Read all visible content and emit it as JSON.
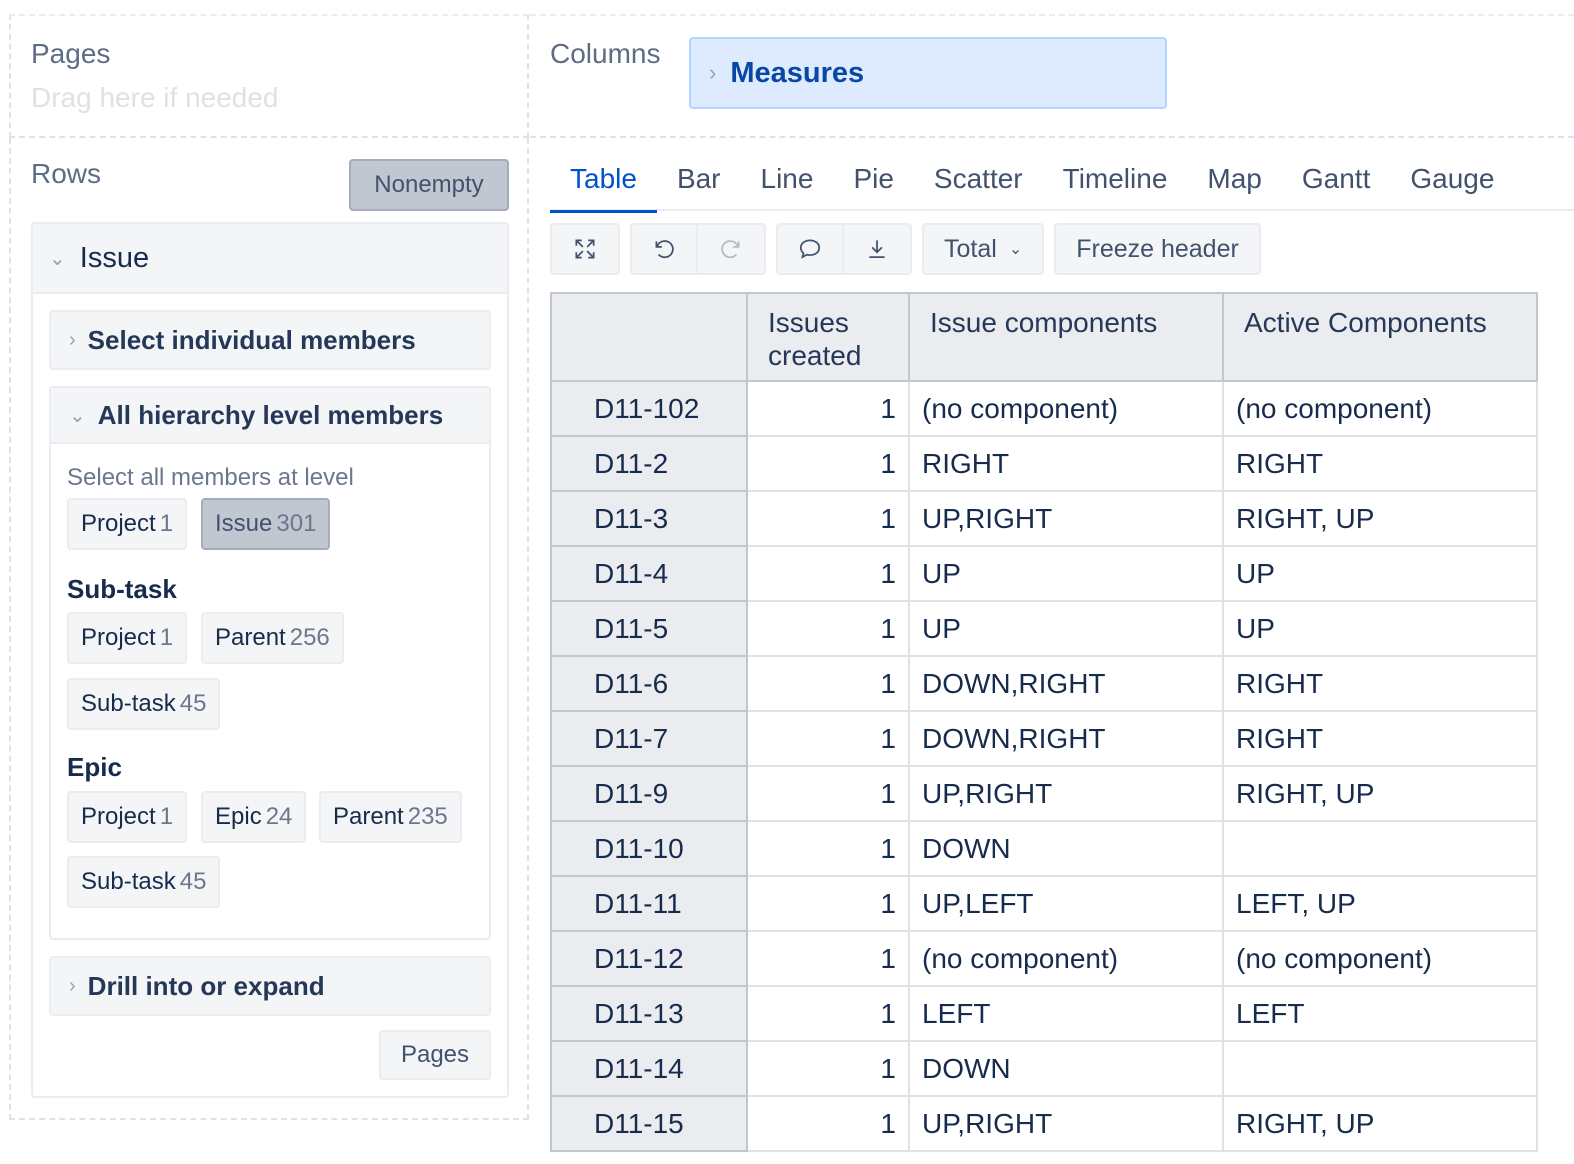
{
  "pages": {
    "title": "Pages",
    "hint": "Drag here if needed"
  },
  "columns": {
    "title": "Columns",
    "measures_label": "Measures"
  },
  "rows": {
    "title": "Rows",
    "nonempty_label": "Nonempty",
    "dimension": "Issue",
    "select_individual": "Select individual members",
    "all_hierarchy": "All hierarchy level members",
    "level_caption": "Select all members at level",
    "default_levels": [
      {
        "label": "Project",
        "count": "1"
      },
      {
        "label": "Issue",
        "count": "301"
      }
    ],
    "subtask_group": {
      "title": "Sub-task",
      "levels": [
        {
          "label": "Project",
          "count": "1"
        },
        {
          "label": "Parent",
          "count": "256"
        },
        {
          "label": "Sub-task",
          "count": "45"
        }
      ]
    },
    "epic_group": {
      "title": "Epic",
      "levels": [
        {
          "label": "Project",
          "count": "1"
        },
        {
          "label": "Epic",
          "count": "24"
        },
        {
          "label": "Parent",
          "count": "235"
        },
        {
          "label": "Sub-task",
          "count": "45"
        }
      ]
    },
    "drill": "Drill into or expand",
    "pages_button": "Pages"
  },
  "tabs": [
    "Table",
    "Bar",
    "Line",
    "Pie",
    "Scatter",
    "Timeline",
    "Map",
    "Gantt",
    "Gauge"
  ],
  "active_tab": "Table",
  "toolbar": {
    "icons": [
      "fullscreen-icon",
      "undo-icon",
      "redo-icon",
      "comment-icon",
      "download-icon"
    ],
    "total_label": "Total",
    "freeze_label": "Freeze header"
  },
  "table": {
    "headers": [
      "",
      "Issues created",
      "Issue components",
      "Active Components"
    ],
    "rows": [
      {
        "key": "D11-102",
        "created": "1",
        "components": "(no component)",
        "active": "(no component)"
      },
      {
        "key": "D11-2",
        "created": "1",
        "components": "RIGHT",
        "active": "RIGHT"
      },
      {
        "key": "D11-3",
        "created": "1",
        "components": "UP,RIGHT",
        "active": "RIGHT, UP"
      },
      {
        "key": "D11-4",
        "created": "1",
        "components": "UP",
        "active": "UP"
      },
      {
        "key": "D11-5",
        "created": "1",
        "components": "UP",
        "active": "UP"
      },
      {
        "key": "D11-6",
        "created": "1",
        "components": "DOWN,RIGHT",
        "active": "RIGHT"
      },
      {
        "key": "D11-7",
        "created": "1",
        "components": "DOWN,RIGHT",
        "active": "RIGHT"
      },
      {
        "key": "D11-9",
        "created": "1",
        "components": "UP,RIGHT",
        "active": "RIGHT, UP"
      },
      {
        "key": "D11-10",
        "created": "1",
        "components": "DOWN",
        "active": ""
      },
      {
        "key": "D11-11",
        "created": "1",
        "components": "UP,LEFT",
        "active": "LEFT, UP"
      },
      {
        "key": "D11-12",
        "created": "1",
        "components": "(no component)",
        "active": "(no component)"
      },
      {
        "key": "D11-13",
        "created": "1",
        "components": "LEFT",
        "active": "LEFT"
      },
      {
        "key": "D11-14",
        "created": "1",
        "components": "DOWN",
        "active": ""
      },
      {
        "key": "D11-15",
        "created": "1",
        "components": "UP,RIGHT",
        "active": "RIGHT, UP"
      }
    ]
  }
}
